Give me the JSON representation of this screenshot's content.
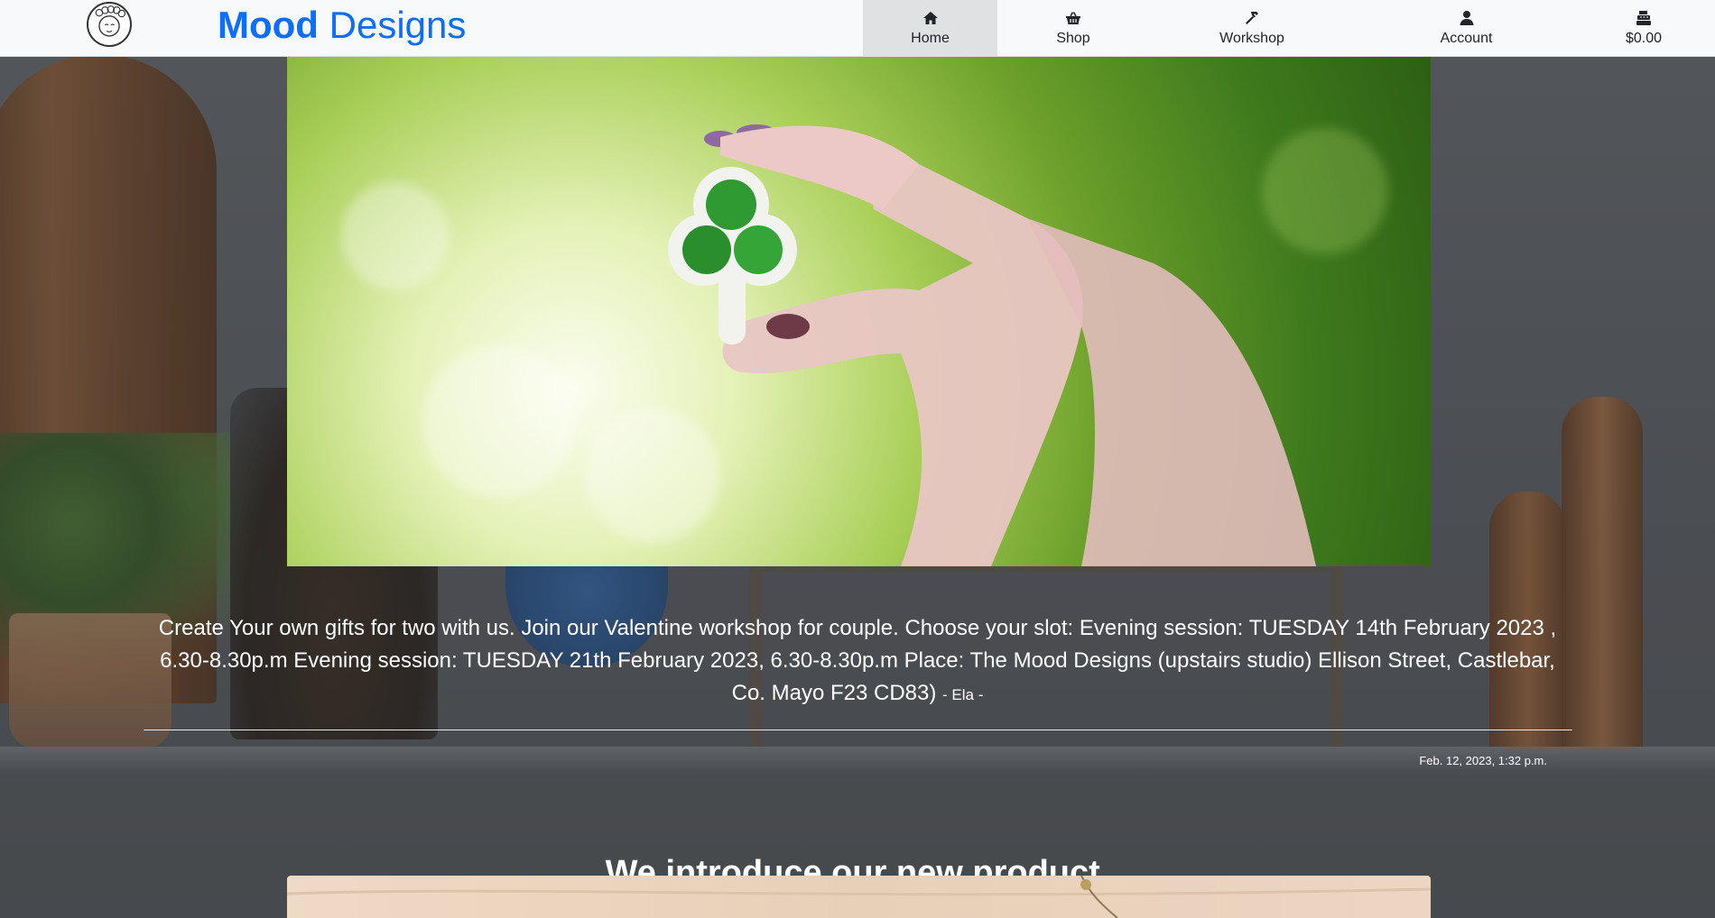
{
  "navbar": {
    "brand_part1": "Mood",
    "brand_part2": "Designs",
    "items": [
      {
        "label": "Home",
        "icon": "home-icon",
        "active": true
      },
      {
        "label": "Shop",
        "icon": "basket-icon",
        "active": false
      },
      {
        "label": "Workshop",
        "icon": "hammer-icon",
        "active": false
      },
      {
        "label": "Account",
        "icon": "user-icon",
        "active": false
      },
      {
        "label": "$0.00",
        "icon": "cash-register-icon",
        "active": false
      }
    ]
  },
  "post": {
    "text": "Create Your own gifts for two with us. Join our Valentine workshop for couple. Choose your slot: Evening session: TUESDAY 14th February 2023 , 6.30-8.30p.m Evening session: TUESDAY 21th February 2023, 6.30-8.30p.m Place: The Mood Designs (upstairs studio) Ellison Street, Castlebar, Co. Mayo F23 CD83)",
    "author": "- Ela -",
    "date": "Feb. 12, 2023, 1:32 p.m."
  },
  "next_section": {
    "title": "We introduce our new product."
  },
  "colors": {
    "brand": "#0d6efd",
    "navbar_bg": "#f8f9fa",
    "active_nav_bg": "#dfe1e3",
    "text_light": "#ffffff"
  }
}
